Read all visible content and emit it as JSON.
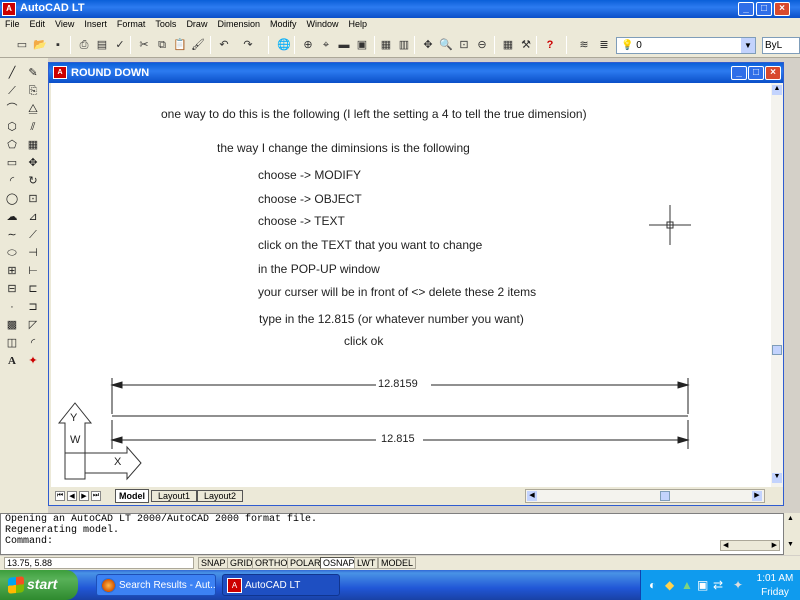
{
  "app": {
    "title": "AutoCAD LT",
    "icon": "autocad-app-icon"
  },
  "window_controls": {
    "minimize": "_",
    "maximize": "□",
    "close": "×"
  },
  "menu": [
    "File",
    "Edit",
    "View",
    "Insert",
    "Format",
    "Tools",
    "Draw",
    "Dimension",
    "Modify",
    "Window",
    "Help"
  ],
  "toolbar": {
    "layer_value": "0",
    "linetype_value": "ByL"
  },
  "drawing_window": {
    "title": "ROUND DOWN",
    "lines": [
      "one way to do this is the following   (I left the setting a 4 to tell the true dimension)",
      "the way I change the diminsions is the following",
      "choose -> MODIFY",
      "choose -> OBJECT",
      "choose -> TEXT",
      "click on the TEXT that you want to change",
      "in the  POP-UP window",
      "your curser will be in front of  <>  delete these 2 items",
      "type in the 12.815  (or whatever number you want)",
      "click ok"
    ],
    "dimension_1": "12.8159",
    "dimension_2": "12.815",
    "ucs": {
      "y": "Y",
      "w": "W",
      "x": "X"
    },
    "tabs": [
      "Model",
      "Layout1",
      "Layout2"
    ],
    "active_tab": "Model"
  },
  "command_line": {
    "history": [
      "Opening an AutoCAD LT 2000/AutoCAD 2000 format file.",
      "Regenerating model."
    ],
    "prompt": "Command:"
  },
  "status_bar": {
    "coordinates": "13.75, 5.88",
    "toggles": [
      "SNAP",
      "GRID",
      "ORTHO",
      "POLAR",
      "OSNAP",
      "LWT",
      "MODEL"
    ]
  },
  "taskbar": {
    "start_label": "start",
    "tasks": [
      {
        "label": "Search Results - Aut..."
      },
      {
        "label": "AutoCAD LT"
      }
    ],
    "clock_time": "1:01 AM",
    "clock_day": "Friday"
  },
  "colors": {
    "xp_blue": "#0a5fd8",
    "start_green": "#3c9e3c",
    "close_red": "#d8492d",
    "chrome": "#ece9d8"
  }
}
